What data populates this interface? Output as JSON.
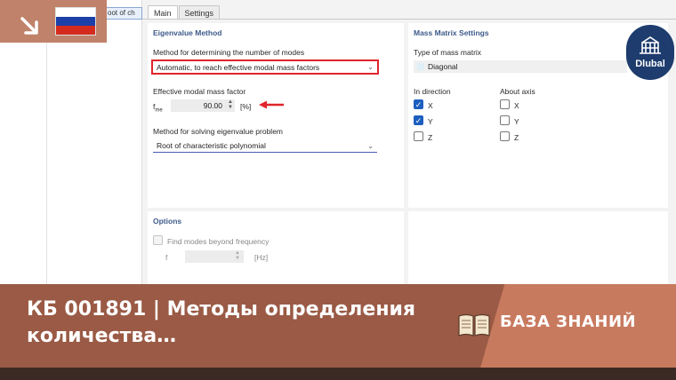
{
  "tree": {
    "item_label": "oot of ch"
  },
  "tabs": [
    {
      "label": "Main"
    },
    {
      "label": "Settings"
    }
  ],
  "eigen": {
    "title": "Eigenvalue Method",
    "method_label": "Method for determining the number of modes",
    "method_value": "Automatic, to reach effective modal mass factors",
    "factor_label": "Effective modal mass factor",
    "factor_symbol": "f",
    "factor_symbol_sub": "me",
    "factor_value": "90.00",
    "factor_unit": "[%]",
    "solve_label": "Method for solving eigenvalue problem",
    "solve_value": "Root of characteristic polynomial"
  },
  "mass": {
    "title": "Mass Matrix Settings",
    "type_label": "Type of mass matrix",
    "type_value": "Diagonal",
    "dir_label": "In direction",
    "axis_label": "About axis",
    "directions": [
      {
        "label": "X",
        "checked": true
      },
      {
        "label": "Y",
        "checked": true
      },
      {
        "label": "Z",
        "checked": false
      }
    ],
    "axes": [
      {
        "label": "X",
        "checked": false
      },
      {
        "label": "Y",
        "checked": false
      },
      {
        "label": "Z",
        "checked": false
      }
    ]
  },
  "options": {
    "title": "Options",
    "find_label": "Find modes beyond frequency",
    "f_symbol": "f",
    "f_unit": "[Hz]"
  },
  "banner": {
    "title": "КБ 001891 | Методы определения количества…",
    "kb_label": "БАЗА ЗНАНИЙ"
  },
  "logo": {
    "text": "Dlubal"
  },
  "colors": {
    "banner": "#9a5a45",
    "banner_right": "#c87a5f",
    "logo": "#1e3c6d",
    "highlight": "#e0242b",
    "check": "#1d5fbf"
  }
}
